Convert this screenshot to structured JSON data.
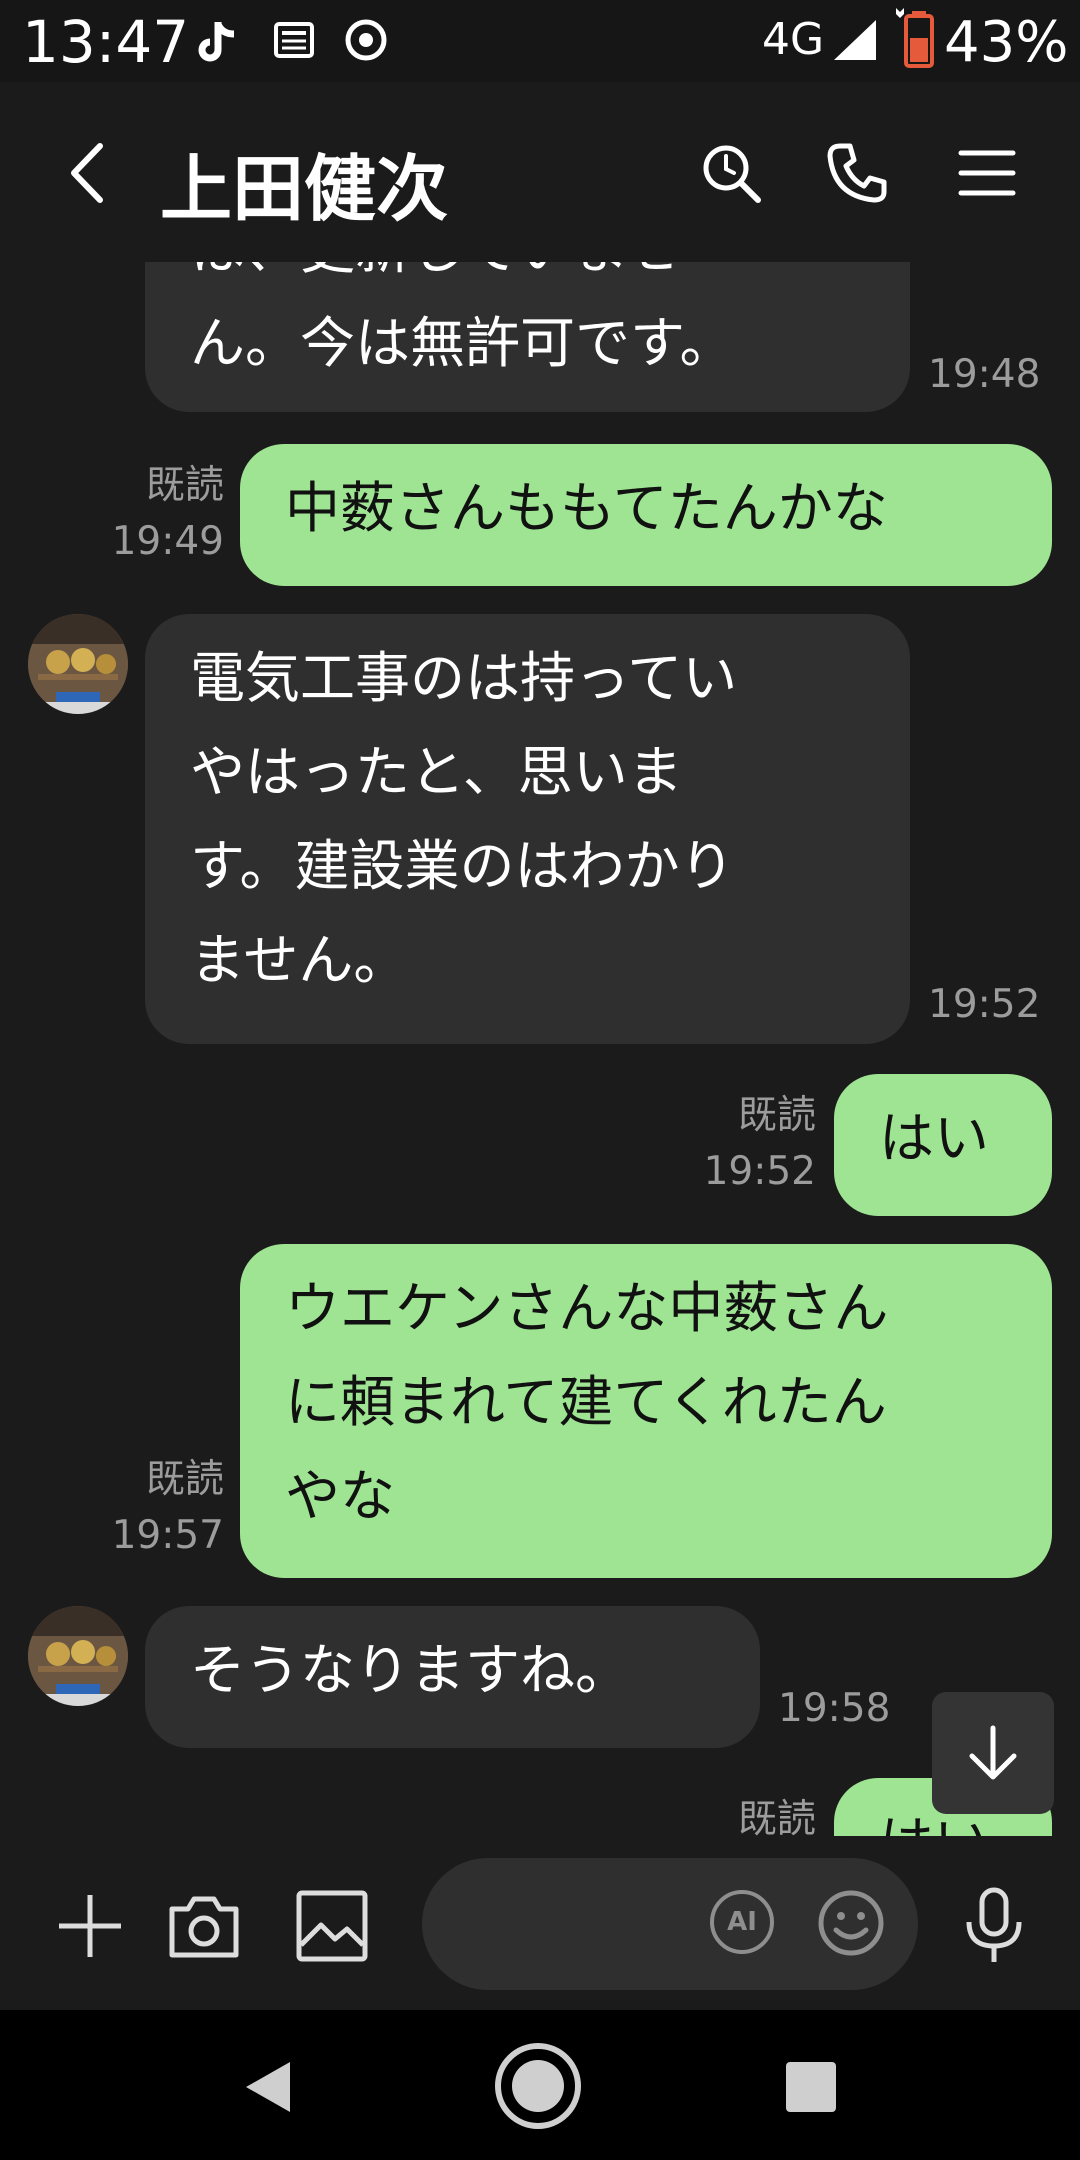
{
  "status_bar": {
    "time": "13:47",
    "network": "4G",
    "battery": "43%"
  },
  "header": {
    "title": "上田健次"
  },
  "messages": [
    {
      "side": "in",
      "lines": [
        "は、更新していませ",
        "ん。今は無許可です。"
      ],
      "time": "19:48"
    },
    {
      "side": "out",
      "lines": [
        "中薮さんももてたんかな"
      ],
      "read": "既読",
      "time": "19:49"
    },
    {
      "side": "in",
      "lines": [
        "電気工事のは持ってい",
        "やはったと、思いま",
        "す。建設業のはわかり",
        "ません。"
      ],
      "time": "19:52"
    },
    {
      "side": "out",
      "lines": [
        "はい"
      ],
      "read": "既読",
      "time": "19:52"
    },
    {
      "side": "out",
      "lines": [
        "ウエケンさんな中薮さん",
        "に頼まれて建てくれたん",
        "やな"
      ],
      "read": "既読",
      "time": "19:57"
    },
    {
      "side": "in",
      "lines": [
        "そうなりますね。"
      ],
      "time": "19:58"
    },
    {
      "side": "out",
      "lines": [
        "はい"
      ],
      "read": "既読"
    }
  ],
  "composer": {
    "placeholder": "",
    "ai_label": "AI"
  },
  "icons": {
    "back": "chevron-left-icon",
    "search": "search-icon",
    "call": "phone-icon",
    "menu": "hamburger-menu-icon",
    "add": "plus-icon",
    "camera": "camera-icon",
    "image": "image-icon",
    "emoji": "emoji-icon",
    "mic": "microphone-icon",
    "scroll_down": "arrow-down-icon"
  },
  "colors": {
    "outgoing_bubble": "#9ee493",
    "incoming_bubble": "#2f2f2f",
    "background": "#1b1b1b"
  }
}
